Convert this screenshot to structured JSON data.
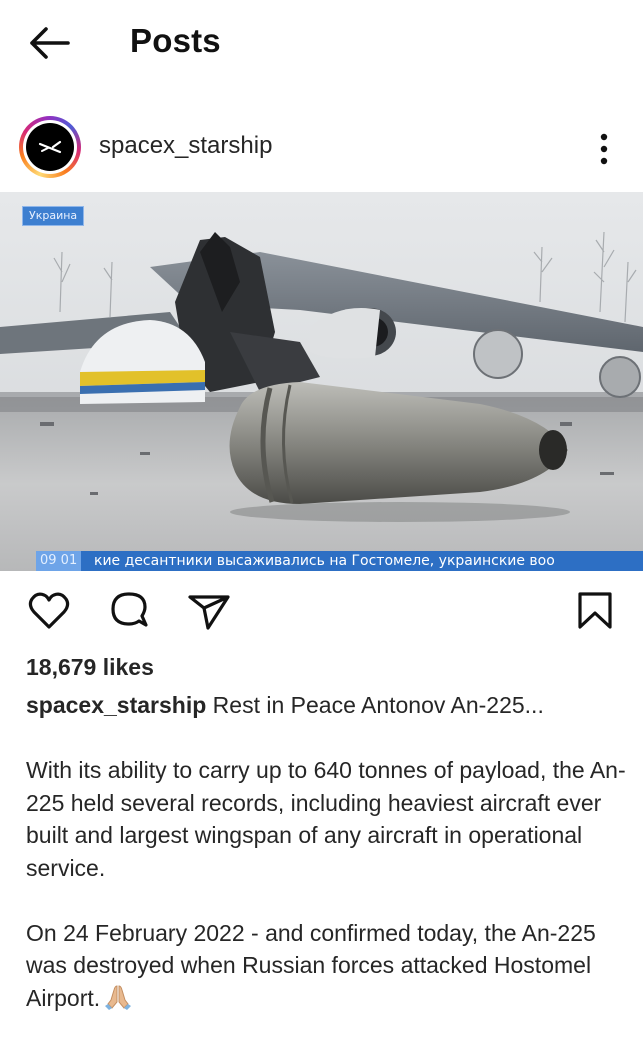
{
  "header": {
    "title": "Posts",
    "back_icon": "arrow-left-icon"
  },
  "post": {
    "username": "spacex_starship",
    "more_icon": "more-vertical-icon",
    "image": {
      "badge": "Украина",
      "ticker_time": "09 01",
      "ticker_text": "кие десантники высаживались на Гостомеле, украинские воо"
    },
    "actions": {
      "like_icon": "heart-icon",
      "comment_icon": "comment-icon",
      "share_icon": "send-icon",
      "save_icon": "bookmark-icon"
    },
    "likes": "18,679 likes",
    "caption": {
      "username": "spacex_starship",
      "line1": "Rest in Peace Antonov An-225...",
      "paragraph2": "With its ability to carry up to 640 tonnes of payload, the An-225 held several records, including heaviest aircraft ever built and largest wingspan of any aircraft in operational service.",
      "paragraph3": "On 24 February 2022 - and confirmed today, the An-225 was destroyed when Russian forces attacked Hostomel Airport.",
      "emoji_icon": "folded-hands-icon"
    }
  },
  "colors": {
    "text": "#262626",
    "ticker": "#2d6fc4"
  }
}
